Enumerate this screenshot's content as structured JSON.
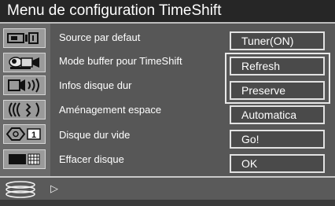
{
  "menu": {
    "title": "Menu de configuration TimeShift"
  },
  "settings": [
    {
      "label": "Source par defaut",
      "value": "Tuner(ON)",
      "icon": "tuner-icon"
    },
    {
      "label": "Mode buffer pour TimeShift",
      "value": "Refresh",
      "icon": "camera-icon"
    },
    {
      "label": "Infos disque dur",
      "value": "Preserve",
      "icon": "speaker-icon"
    },
    {
      "label": "Aménagement espace",
      "value": "Automatica",
      "icon": "signal-waves-icon"
    },
    {
      "label": "Disque dur vide",
      "value": "Go!",
      "icon": "disc-number-icon"
    },
    {
      "label": "Effacer disque",
      "value": "OK",
      "icon": "tv-grid-icon"
    }
  ],
  "left_icons": {
    "disc_badge": "1"
  },
  "bottom": {
    "icon": "disk-stack-icon",
    "arrow": "▷"
  },
  "colors": {
    "background": "#4f4f4f",
    "title_bar": "#262626",
    "button_border": "#e2e2e2",
    "text": "#ffffff"
  }
}
